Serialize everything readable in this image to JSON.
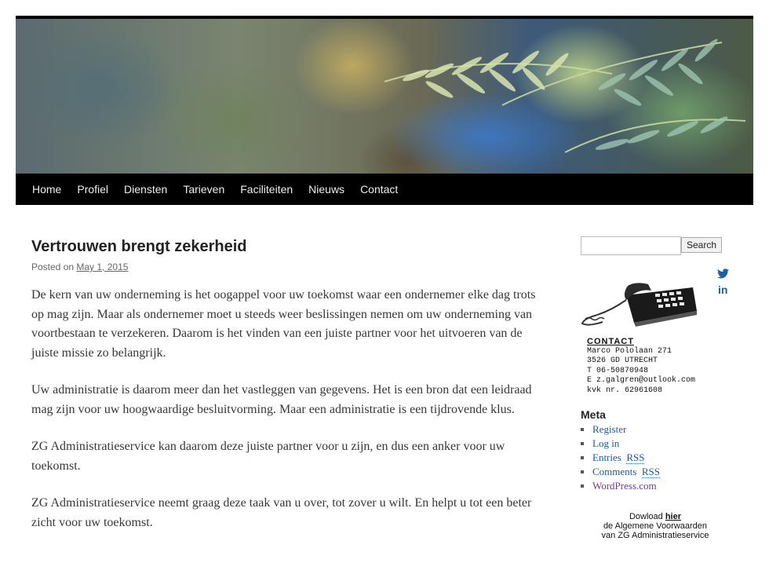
{
  "nav": {
    "items": [
      "Home",
      "Profiel",
      "Diensten",
      "Tarieven",
      "Faciliteiten",
      "Nieuws",
      "Contact"
    ]
  },
  "post": {
    "title": "Vertrouwen brengt zekerheid",
    "posted_prefix": "Posted on",
    "date": "May 1, 2015",
    "paragraphs": [
      "De kern van uw onderneming is het oogappel voor uw toekomst waar een ondernemer elke dag trots op mag zijn. Maar als ondernemer moet u steeds weer beslissingen nemen om uw onderneming van voortbestaan te verzekeren. Daarom is het vinden van een juiste partner voor het uitvoeren van de juiste missie zo belangrijk.",
      "Uw administratie is daarom meer dan het vastleggen van gegevens. Het is een bron dat een leidraad mag zijn voor uw hoogwaardige besluitvorming. Maar een administratie is een tijdrovende klus.",
      "ZG Administratieservice kan daarom deze juiste partner voor u zijn, en dus een anker voor uw toekomst.",
      "ZG Administratieservice neemt graag deze taak van u over, tot zover u wilt. En helpt u tot een beter zicht voor uw toekomst."
    ]
  },
  "sidebar": {
    "search_button": "Search",
    "search_placeholder": "",
    "social": {
      "linkedin": "in"
    },
    "contact": {
      "heading": "CONTACT",
      "lines": [
        "Marco Pololaan 271",
        "3526 GD UTRECHT",
        "T 06-50870948",
        "E z.galgren@outlook.com",
        "kvk nr. 62961608"
      ]
    },
    "meta": {
      "title": "Meta",
      "register": "Register",
      "login": "Log in",
      "entries_pre": "Entries ",
      "comments_pre": "Comments ",
      "rss": "RSS",
      "wordpress": "WordPress.com"
    },
    "download": {
      "line1_pre": "Dowload ",
      "line1_link": "hier",
      "line2": "de Algemene Voorwaarden",
      "line3": "van ZG Administratieservice"
    }
  },
  "colors": {
    "nav_bg": "#000000",
    "link": "#1b5a9a",
    "visited": "#6a3f8a",
    "social": "#1a5fa8"
  }
}
